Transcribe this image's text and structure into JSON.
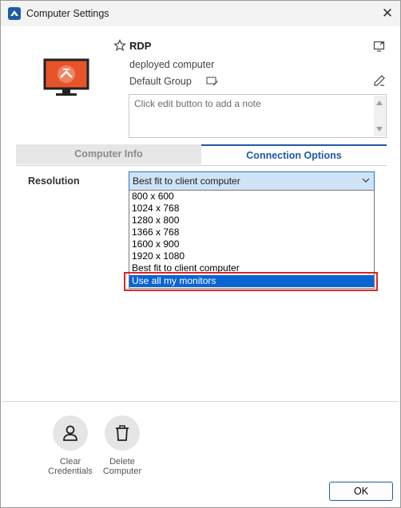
{
  "window": {
    "title": "Computer Settings",
    "close_glyph": "✕"
  },
  "computer": {
    "name": "RDP",
    "description": "deployed computer",
    "group": "Default Group",
    "note_placeholder": "Click edit button to add a note"
  },
  "tabs": [
    {
      "label": "Computer Info",
      "active": false
    },
    {
      "label": "Connection Options",
      "active": true
    }
  ],
  "resolution": {
    "label": "Resolution",
    "selected": "Best fit to client computer",
    "options": [
      "800 x 600",
      "1024 x 768",
      "1280 x 800",
      "1366 x 768",
      "1600 x 900",
      "1920 x 1080",
      "Best fit to client computer",
      "Use all my monitors"
    ],
    "highlighted_index": 7
  },
  "actions": [
    {
      "label_line1": "Clear",
      "label_line2": "Credentials",
      "icon": "user-icon"
    },
    {
      "label_line1": "Delete",
      "label_line2": "Computer",
      "icon": "trash-icon"
    }
  ],
  "buttons": {
    "ok": "OK"
  },
  "colors": {
    "accent": "#1f5aa6",
    "selection": "#0a64d2",
    "monitor_orange": "#e8542a",
    "annotation_red": "#e02424"
  }
}
